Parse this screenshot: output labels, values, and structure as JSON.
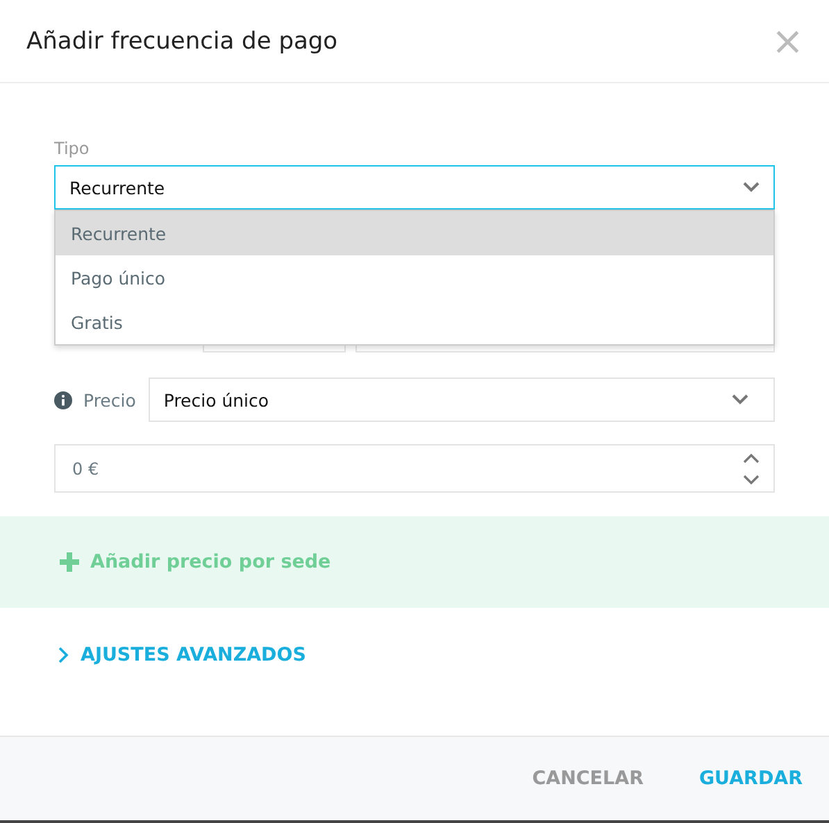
{
  "dialog": {
    "title": "Añadir frecuencia de pago",
    "close": "×"
  },
  "tipo": {
    "label": "Tipo",
    "value": "Recurrente",
    "expanded": true,
    "options": [
      {
        "label": "Recurrente",
        "selected": true
      },
      {
        "label": "Pago único",
        "selected": false
      },
      {
        "label": "Gratis",
        "selected": false
      }
    ]
  },
  "precio": {
    "label": "Precio",
    "value": "Precio único"
  },
  "amount": {
    "value": "0 €"
  },
  "add_price": {
    "label": "Añadir precio por sede"
  },
  "advanced": {
    "label": "AJUSTES AVANZADOS",
    "expanded": false
  },
  "buttons": [
    {
      "label": "CANCELAR",
      "kind": "secondary"
    },
    {
      "label": "GUARDAR",
      "kind": "primary"
    }
  ]
}
